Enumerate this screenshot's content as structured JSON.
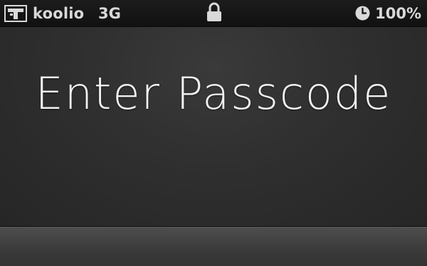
{
  "status_bar": {
    "carrier": "koolio",
    "network": "3G",
    "battery": "100%",
    "icons": {
      "carrier_logo": "carrier-logo-icon",
      "lock": "lock-icon",
      "clock": "clock-icon"
    }
  },
  "passcode_screen": {
    "title": "Enter Passcode"
  },
  "colors": {
    "background": "#2b2b2b",
    "status_bar": "#151515",
    "status_text": "#d9d9d9",
    "title_text": "#f2f2f2",
    "keypad": "#444444"
  }
}
